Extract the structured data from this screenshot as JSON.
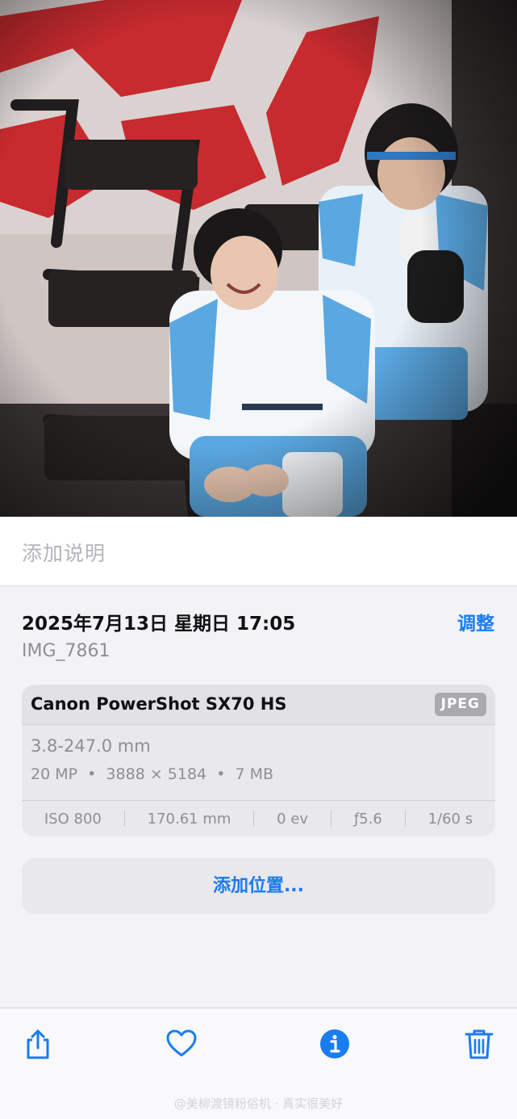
{
  "photo": {
    "description_icon": "photo-image"
  },
  "caption": {
    "placeholder": "添加说明"
  },
  "info": {
    "date_time": "2025年7月13日 星期日 17:05",
    "adjust_label": "调整",
    "file_name": "IMG_7861"
  },
  "meta": {
    "camera": "Canon PowerShot SX70 HS",
    "format": "JPEG",
    "lens": "3.8-247.0 mm",
    "specs": "20 MP  •  3888 × 5184  •  7 MB",
    "exif": {
      "iso": "ISO 800",
      "focal_length": "170.61 mm",
      "exposure": "0 ev",
      "aperture": "ƒ5.6",
      "shutter": "1/60 s"
    }
  },
  "location": {
    "add_label": "添加位置..."
  },
  "toolbar": {
    "icons": [
      "share-icon",
      "heart-icon",
      "info-icon",
      "trash-icon"
    ],
    "accent_color": "#1a7cf0"
  },
  "watermark": "@美柳渡镜粉俗机 · 真实很美好"
}
